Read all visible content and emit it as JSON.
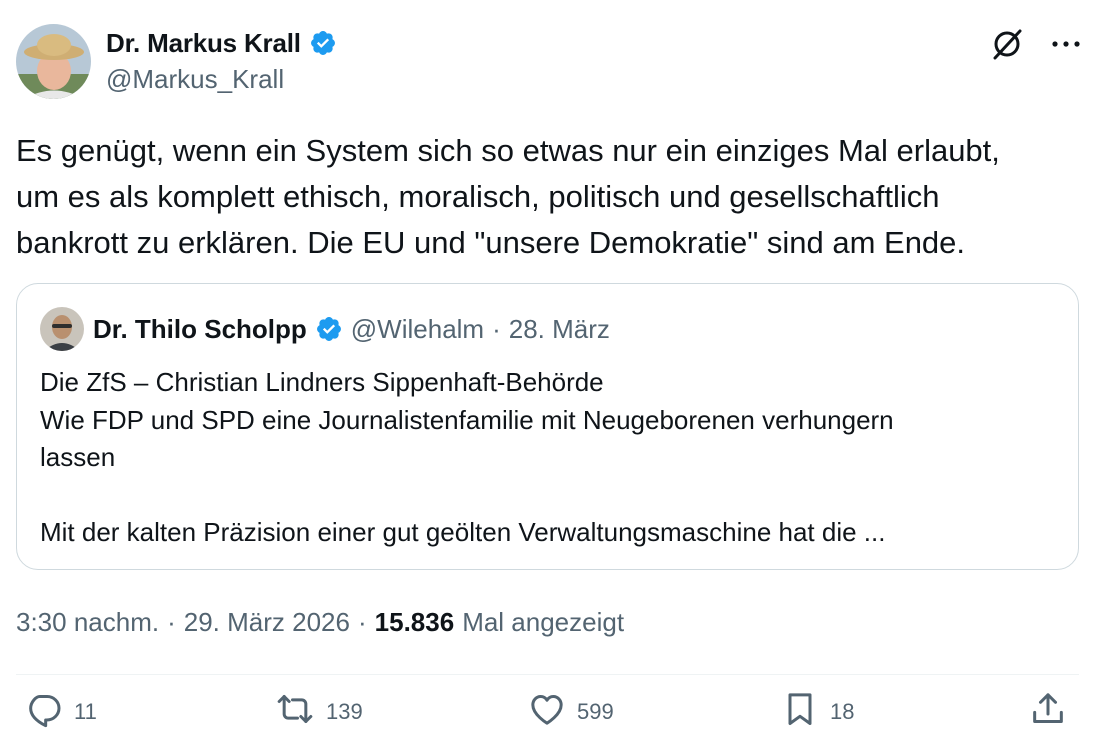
{
  "tweet": {
    "author": {
      "name": "Dr. Markus Krall",
      "handle": "@Markus_Krall",
      "verified": true
    },
    "text": "Es genügt, wenn ein System sich so etwas nur ein einziges Mal erlaubt,\num es als komplett ethisch, moralisch, politisch und gesellschaftlich\nbankrott zu erklären. Die EU und \"unsere Demokratie\" sind am Ende.",
    "quote": {
      "author_name": "Dr. Thilo Scholpp",
      "handle": "@Wilehalm",
      "separator": "·",
      "date": "28. März",
      "text": "Die ZfS – Christian Lindners Sippenhaft-Behörde\nWie FDP und SPD eine Journalistenfamilie mit Neugeborenen verhungern\nlassen\n\nMit der kalten Präzision einer gut geölten Verwaltungsmaschine hat die ..."
    },
    "meta": {
      "time": "3:30 nachm.",
      "date": "29. März 2026",
      "views": "15.836",
      "views_label": "Mal angezeigt",
      "separator": "·"
    },
    "stats": {
      "replies": "11",
      "reposts": "139",
      "likes": "599",
      "bookmarks": "18"
    }
  },
  "icons": {
    "verified": "verified-badge-icon",
    "grok": "grok-icon",
    "more": "more-icon",
    "reply": "reply-icon",
    "repost": "repost-icon",
    "like": "like-icon",
    "bookmark": "bookmark-icon",
    "share": "share-icon"
  },
  "colors": {
    "text_primary": "#0f1419",
    "text_secondary": "#536471",
    "verified_blue": "#1d9bf0",
    "border": "#cfd9de"
  }
}
